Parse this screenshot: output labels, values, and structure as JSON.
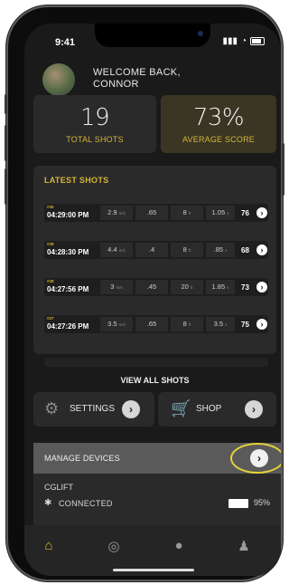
{
  "status": {
    "time": "9:41"
  },
  "profile": {
    "greeting_line1": "WELCOME BACK,",
    "greeting_line2": "CONNOR"
  },
  "stats": {
    "total_shots": {
      "value": "19",
      "label": "TOTAL SHOTS"
    },
    "average_score": {
      "value": "73%",
      "label": "AVERAGE SCORE"
    }
  },
  "latest_shots": {
    "title": "LATEST SHOTS",
    "view_all_label": "VIEW ALL SHOTS",
    "rows": [
      {
        "number": "#30",
        "time": "04:29:00 PM",
        "c1": "2.9",
        "c1u": "m/s",
        "c2": ".65",
        "c3": "8",
        "c3u": "ft",
        "c4": "1.05",
        "c4u": "s",
        "score": "76"
      },
      {
        "number": "#29",
        "time": "04:28:30 PM",
        "c1": "4.4",
        "c1u": "m/s",
        "c2": ".4",
        "c3": "8",
        "c3u": "ft",
        "c4": ".85",
        "c4u": "s",
        "score": "68"
      },
      {
        "number": "#28",
        "time": "04:27:56 PM",
        "c1": "3",
        "c1u": "m/s",
        "c2": ".45",
        "c3": "20",
        "c3u": "ft",
        "c4": "1.85",
        "c4u": "s",
        "score": "73"
      },
      {
        "number": "#27",
        "time": "04:27:26 PM",
        "c1": "3.5",
        "c1u": "m/s",
        "c2": ".65",
        "c3": "8",
        "c3u": "ft",
        "c4": "3.5",
        "c4u": "s",
        "score": "75"
      }
    ]
  },
  "buttons": {
    "settings": "SETTINGS",
    "shop": "SHOP"
  },
  "devices": {
    "title": "MANAGE DEVICES",
    "device_name": "CGLIFT",
    "connection_status": "CONNECTED",
    "battery": "95%"
  },
  "icons": {
    "home": "home-icon",
    "target": "target-icon",
    "chat": "chat-icon",
    "profile": "profile-icon",
    "gear": "gear-icon",
    "cart": "cart-icon",
    "bluetooth": "bluetooth-icon"
  },
  "colors": {
    "accent": "#d4b63a",
    "highlight_ring": "#e8d23a",
    "background": "#1a1a1a",
    "card": "#2a2a2a"
  }
}
